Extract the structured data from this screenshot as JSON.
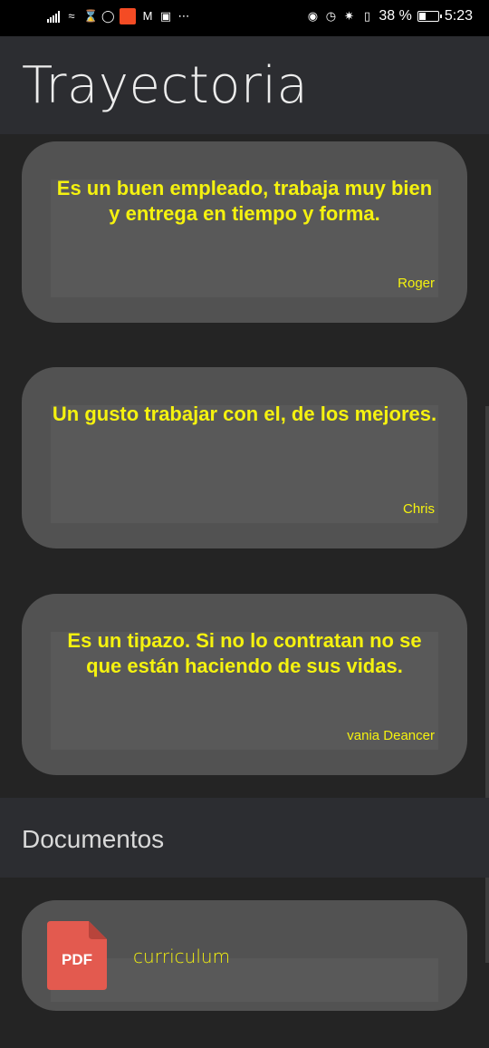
{
  "status_bar": {
    "battery_percent": "38 %",
    "time": "5:23",
    "battery_level": 0.38
  },
  "app_bar": {
    "title": "Trayectoria"
  },
  "testimonials": [
    {
      "quote": "Es un buen empleado, trabaja muy bien y entrega en tiempo y forma.",
      "author": "Roger"
    },
    {
      "quote": "Un gusto trabajar con el, de los mejores.",
      "author": "Chris"
    },
    {
      "quote": "Es un tipazo. Si no lo contratan no se que están haciendo de sus vidas.",
      "author": "vania Deancer"
    }
  ],
  "documents_section": {
    "title": "Documentos",
    "items": [
      {
        "icon": "pdf-file-icon",
        "icon_label": "PDF",
        "name": "curriculum"
      }
    ]
  },
  "colors": {
    "accent_text": "#f5f20f",
    "card_bg": "#525252",
    "app_bar_bg": "#2c2d31",
    "page_bg": "#242424",
    "pdf_red": "#e35a4f"
  }
}
